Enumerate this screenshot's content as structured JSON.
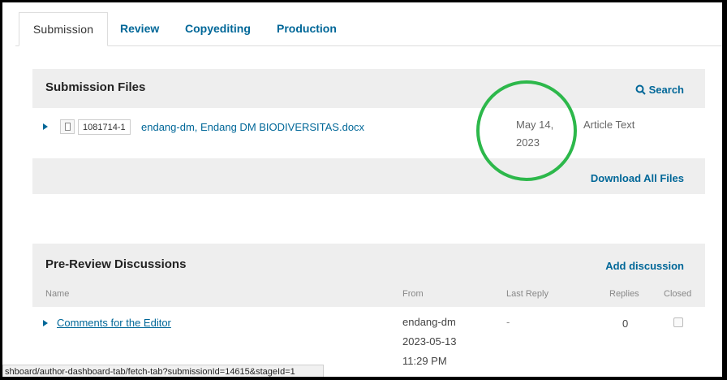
{
  "tabs": [
    {
      "label": "Submission"
    },
    {
      "label": "Review"
    },
    {
      "label": "Copyediting"
    },
    {
      "label": "Production"
    }
  ],
  "submission_files": {
    "title": "Submission Files",
    "search_label": "Search",
    "file": {
      "id": "1081714-1",
      "name": "endang-dm, Endang DM BIODIVERSITAS.docx",
      "date_line1": "May 14,",
      "date_line2": "2023",
      "type": "Article Text"
    },
    "download_label": "Download All Files"
  },
  "discussions": {
    "title": "Pre-Review Discussions",
    "add_label": "Add discussion",
    "columns": [
      "Name",
      "From",
      "Last Reply",
      "Replies",
      "Closed"
    ],
    "rows": [
      {
        "name": "Comments for the Editor",
        "from_user": "endang-dm",
        "from_date": "2023-05-13",
        "from_time": "11:29 PM",
        "last_reply": "-",
        "replies": "0"
      }
    ]
  },
  "status_url": "shboard/author-dashboard-tab/fetch-tab?submissionId=14615&stageId=1",
  "colors": {
    "link": "#006798",
    "annotation_circle": "#2db84b"
  }
}
